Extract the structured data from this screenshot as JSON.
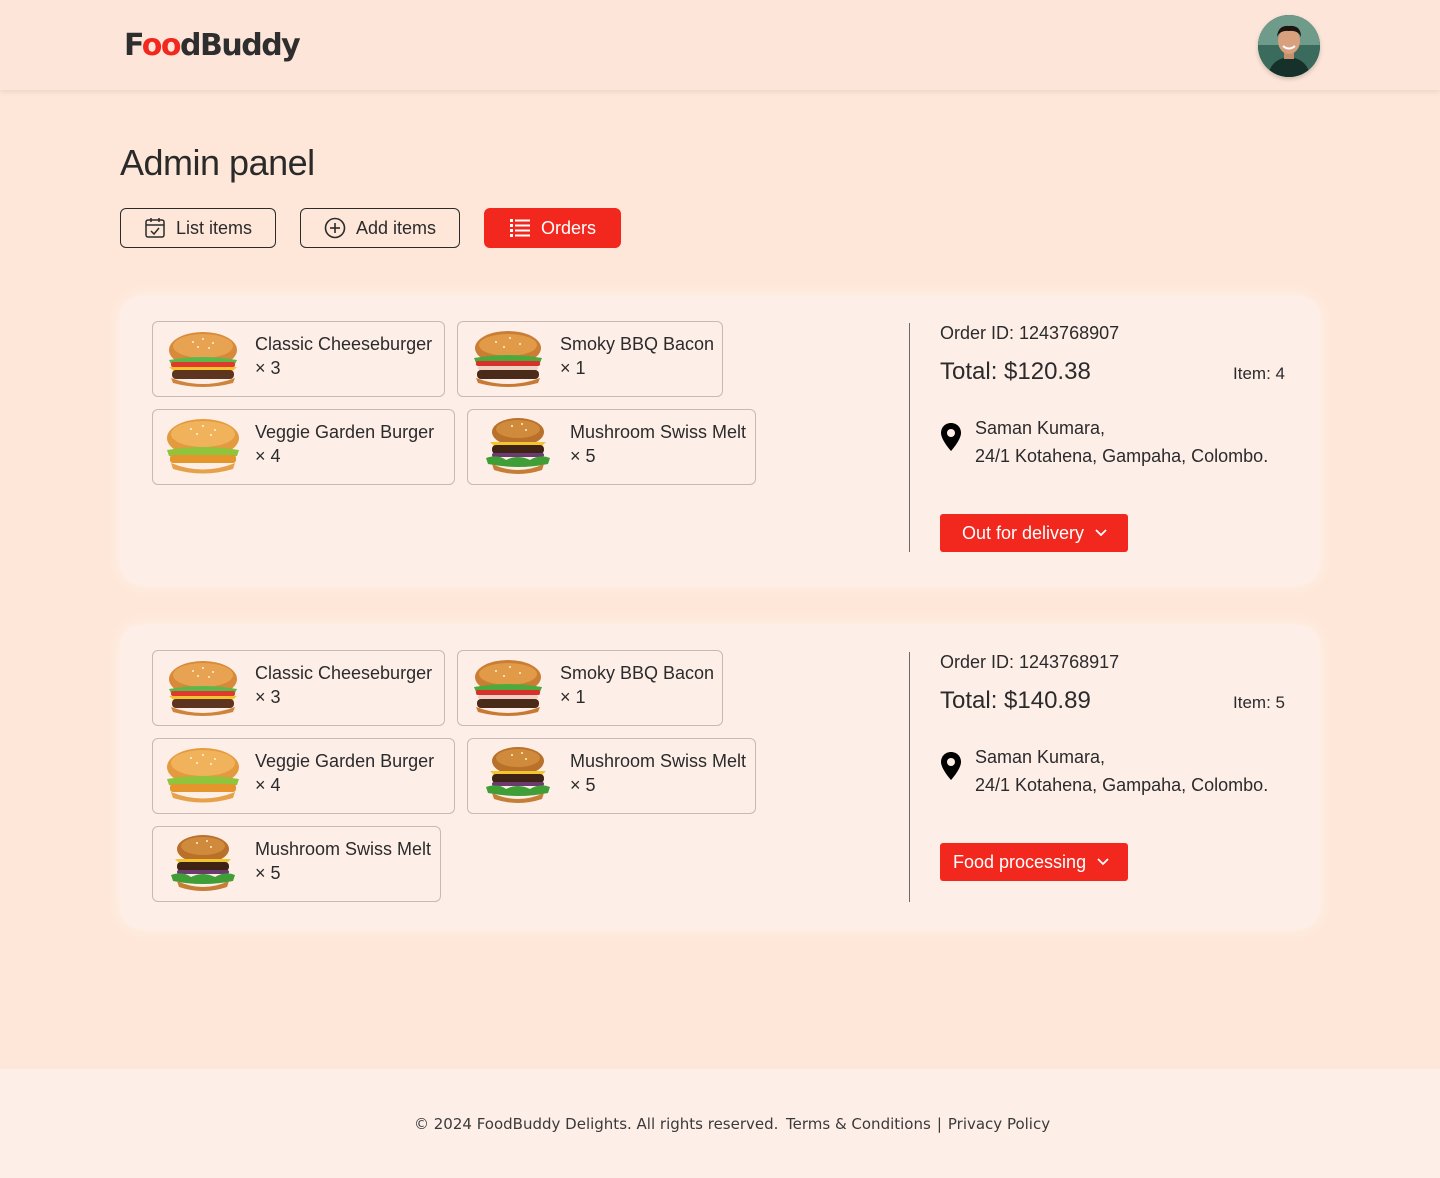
{
  "header": {
    "logo_prefix": "F",
    "logo_oo": "oo",
    "logo_suffix": "dBuddy"
  },
  "page": {
    "title": "Admin panel"
  },
  "tabs": [
    {
      "label": "List items",
      "icon": "calendar-check-icon"
    },
    {
      "label": "Add items",
      "icon": "plus-circle-icon"
    },
    {
      "label": "Orders",
      "icon": "list-icon",
      "active": true
    }
  ],
  "orders": [
    {
      "order_id": "Order ID: 1243768907",
      "total": "Total: $120.38",
      "item_count": "Item: 4",
      "address_name": "Saman Kumara,",
      "address_line": "24/1 Kotahena, Gampaha, Colombo.",
      "status": "Out for delivery",
      "items": [
        {
          "name": "Classic Cheeseburger",
          "qty": "× 3"
        },
        {
          "name": "Smoky BBQ Bacon",
          "qty": "× 1"
        },
        {
          "name": "Veggie Garden Burger",
          "qty": "× 4"
        },
        {
          "name": "Mushroom Swiss Melt",
          "qty": "× 5"
        }
      ]
    },
    {
      "order_id": "Order ID: 1243768917",
      "total": "Total: $140.89",
      "item_count": "Item: 5",
      "address_name": "Saman Kumara,",
      "address_line": "24/1 Kotahena, Gampaha, Colombo.",
      "status": "Food processing",
      "items": [
        {
          "name": "Classic Cheeseburger",
          "qty": "× 3"
        },
        {
          "name": "Smoky BBQ Bacon",
          "qty": "× 1"
        },
        {
          "name": "Veggie Garden Burger",
          "qty": "× 4"
        },
        {
          "name": "Mushroom Swiss Melt",
          "qty": "× 5"
        },
        {
          "name": "Mushroom Swiss Melt",
          "qty": "× 5"
        }
      ]
    }
  ],
  "footer": {
    "copyright": "© 2024 FoodBuddy Delights. All rights reserved.",
    "terms": "Terms & Conditions",
    "separator": "|",
    "privacy": "Privacy Policy"
  },
  "colors": {
    "accent": "#f2281e",
    "background": "#fee7d8",
    "card": "#feeee8"
  }
}
